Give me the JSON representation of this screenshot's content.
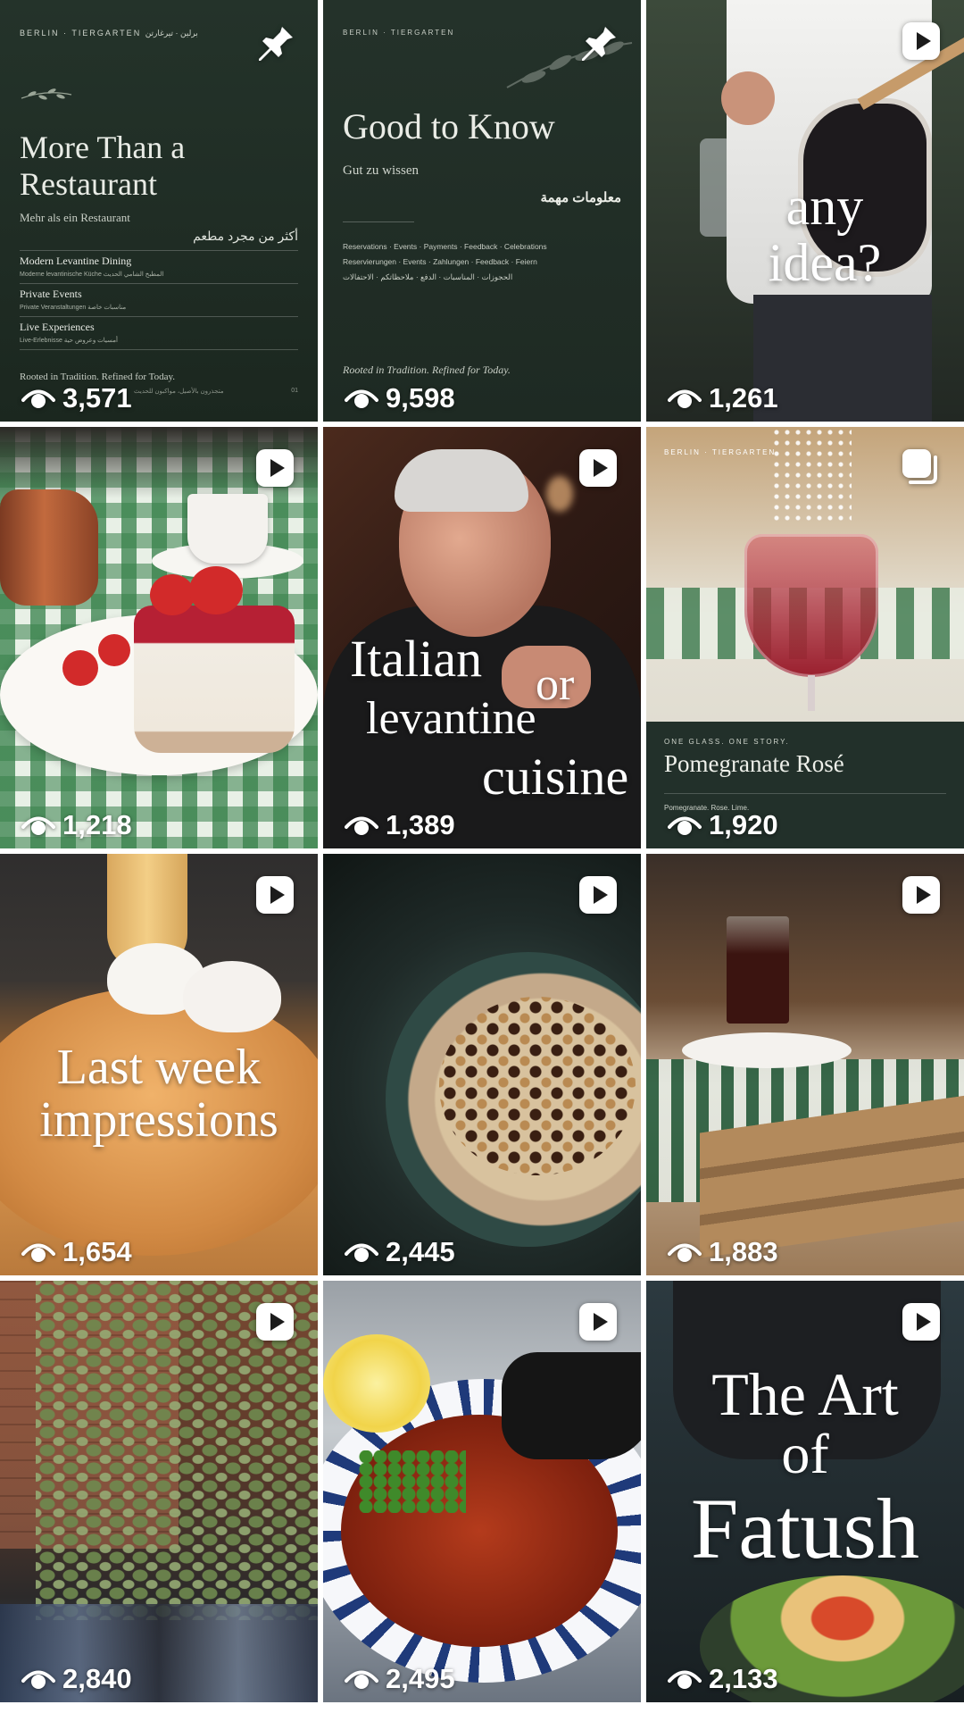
{
  "icons": {
    "views": "eye-icon",
    "pinned": "pin-icon",
    "reel": "reel-play-icon",
    "carousel": "carousel-icon"
  },
  "tiles": [
    {
      "type": "pinned",
      "views": "3,571",
      "top": "BERLIN · TIERGARTEN   برلين · تيرغارتن",
      "title": "More Than a Restaurant",
      "subtitle": "Mehr als ein Restaurant",
      "arabic": "أكثر من مجرد مطعم",
      "rows": [
        {
          "title": "Modern Levantine Dining",
          "sub": "Moderne levantinische Küche   المطبخ الشامي الحديث"
        },
        {
          "title": "Private Events",
          "sub": "Private Veranstaltungen   مناسبات خاصة"
        },
        {
          "title": "Live Experiences",
          "sub": "Live-Erlebnisse   أمسيات وعروض حية"
        }
      ],
      "motto": "Rooted in Tradition. Refined for Today.",
      "motto_ar": "متجذرون بالأصيل، مواكبون للحديث",
      "page": "01"
    },
    {
      "type": "pinned",
      "views": "9,598",
      "top": "BERLIN · TIERGARTEN",
      "title": "Good to Know",
      "subtitle": "Gut zu wissen",
      "arabic": "معلومات مهمة",
      "tags_en": "Reservations · Events · Payments · Feedback · Celebrations",
      "tags_de": "Reservierungen · Events · Zahlungen · Feedback · Feiern",
      "tags_ar": "الحجوزات · المناسبات · الدفع · ملاحظاتكم · الاحتفالات",
      "motto": "Rooted in Tradition. Refined for Today."
    },
    {
      "type": "reel",
      "views": "1,261",
      "overlay": "any idea?"
    },
    {
      "type": "reel",
      "views": "1,218",
      "overlay": ""
    },
    {
      "type": "reel",
      "views": "1,389",
      "overlay_line1": "Italian",
      "overlay_or": "or",
      "overlay_line2": "levantine",
      "overlay_line3": "cuisine"
    },
    {
      "type": "carousel",
      "views": "1,920",
      "top": "BERLIN · TIERGARTEN",
      "kicker": "ONE GLASS. ONE STORY.",
      "title": "Pomegranate Rosé",
      "desc": "Pomegranate. Rose. Lime."
    },
    {
      "type": "reel",
      "views": "1,654",
      "overlay": "Last week impressions"
    },
    {
      "type": "reel",
      "views": "2,445",
      "overlay": ""
    },
    {
      "type": "reel",
      "views": "1,883",
      "overlay": ""
    },
    {
      "type": "reel",
      "views": "2,840",
      "overlay": ""
    },
    {
      "type": "reel",
      "views": "2,495",
      "overlay": ""
    },
    {
      "type": "reel",
      "views": "2,133",
      "overlay_line1": "The Art",
      "overlay_line2": "of",
      "overlay_line3": "Fatush"
    }
  ]
}
